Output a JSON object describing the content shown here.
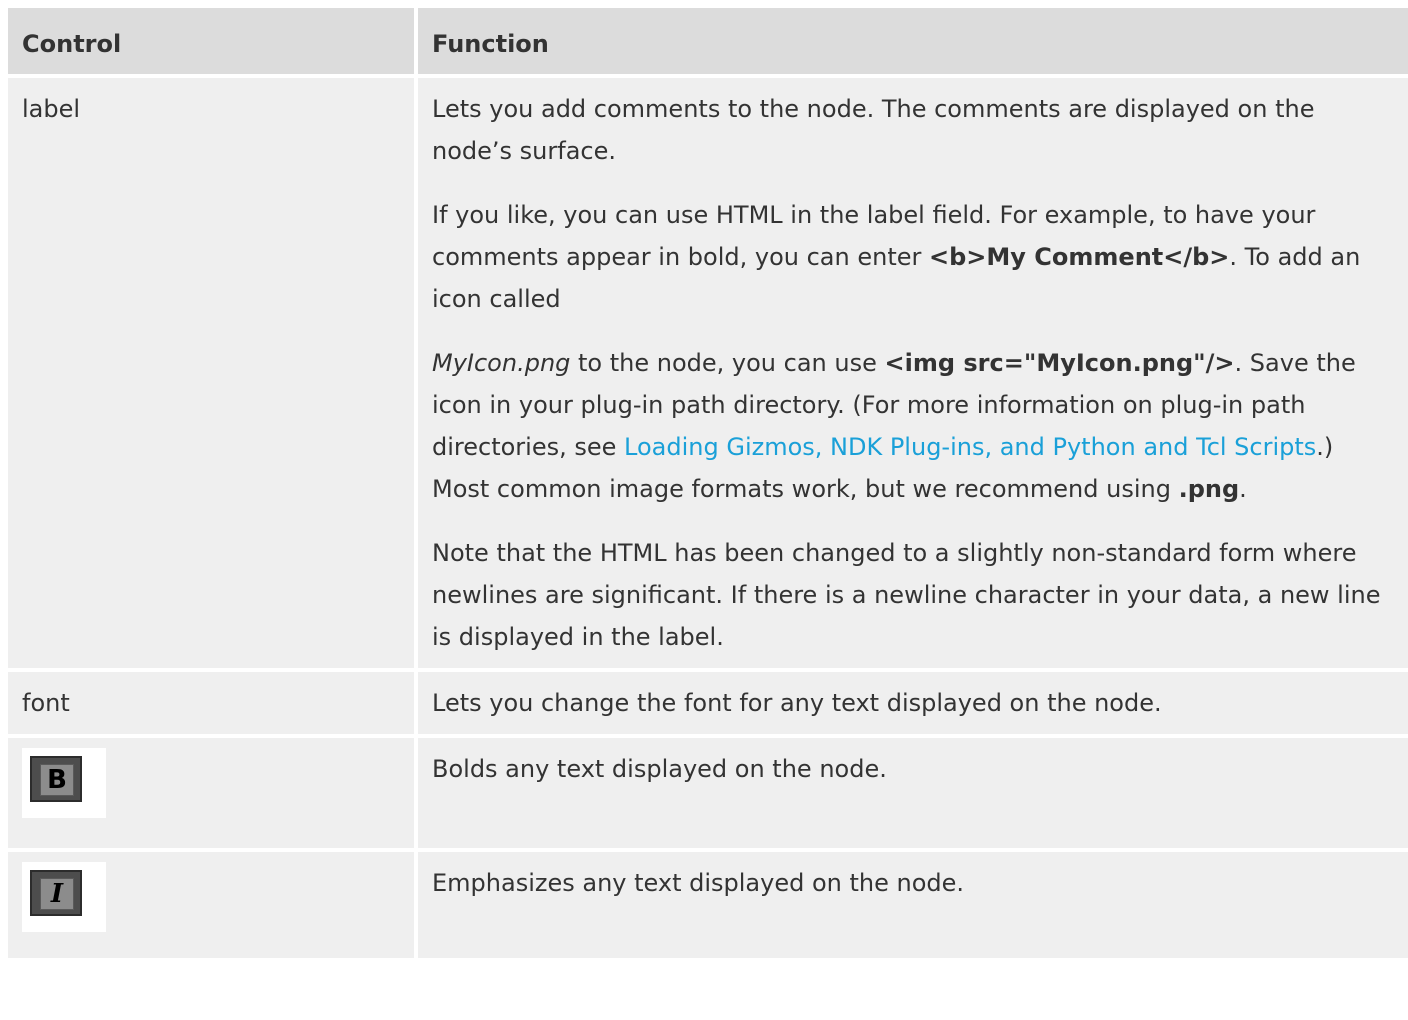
{
  "header": {
    "control": "Control",
    "function": "Function"
  },
  "rows": [
    {
      "control": "label",
      "paragraphs": [
        {
          "text": "Lets you add comments to the node. The comments are displayed on the node’s surface."
        },
        {
          "pre": "If you like, you can use HTML in the label field. For example, to have your comments appear in bold, you can enter ",
          "code": "<b>My Comment</b>",
          "post": ". To add an icon called"
        },
        {
          "italic": "MyIcon.png",
          "pre": " to the node, you can use ",
          "code": "<img src=\"MyIcon.png\"/>",
          "mid": ". Save the icon in your plug-in path directory. (For more information on plug-in path directories, see ",
          "link": "Loading Gizmos, NDK Plug-ins, and Python and Tcl Scripts",
          "after_link": ".) Most common image formats work, but we recommend using ",
          "ext": ".png",
          "end": "."
        },
        {
          "text": "Note that the HTML has been changed to a slightly non-standard form where newlines are significant. If there is a newline character in your data, a new line is displayed in the label."
        }
      ]
    },
    {
      "control": "font",
      "function": "Lets you change the font for any text displayed on the node."
    },
    {
      "control_icon": "bold-button-icon",
      "glyph": "B",
      "function": "Bolds any text displayed on the node."
    },
    {
      "control_icon": "italic-button-icon",
      "glyph": "I",
      "function": "Emphasizes any text displayed on the node."
    }
  ],
  "colors": {
    "header_bg": "#dcdcdc",
    "cell_bg": "#efefef",
    "link": "#1aa0d8"
  }
}
